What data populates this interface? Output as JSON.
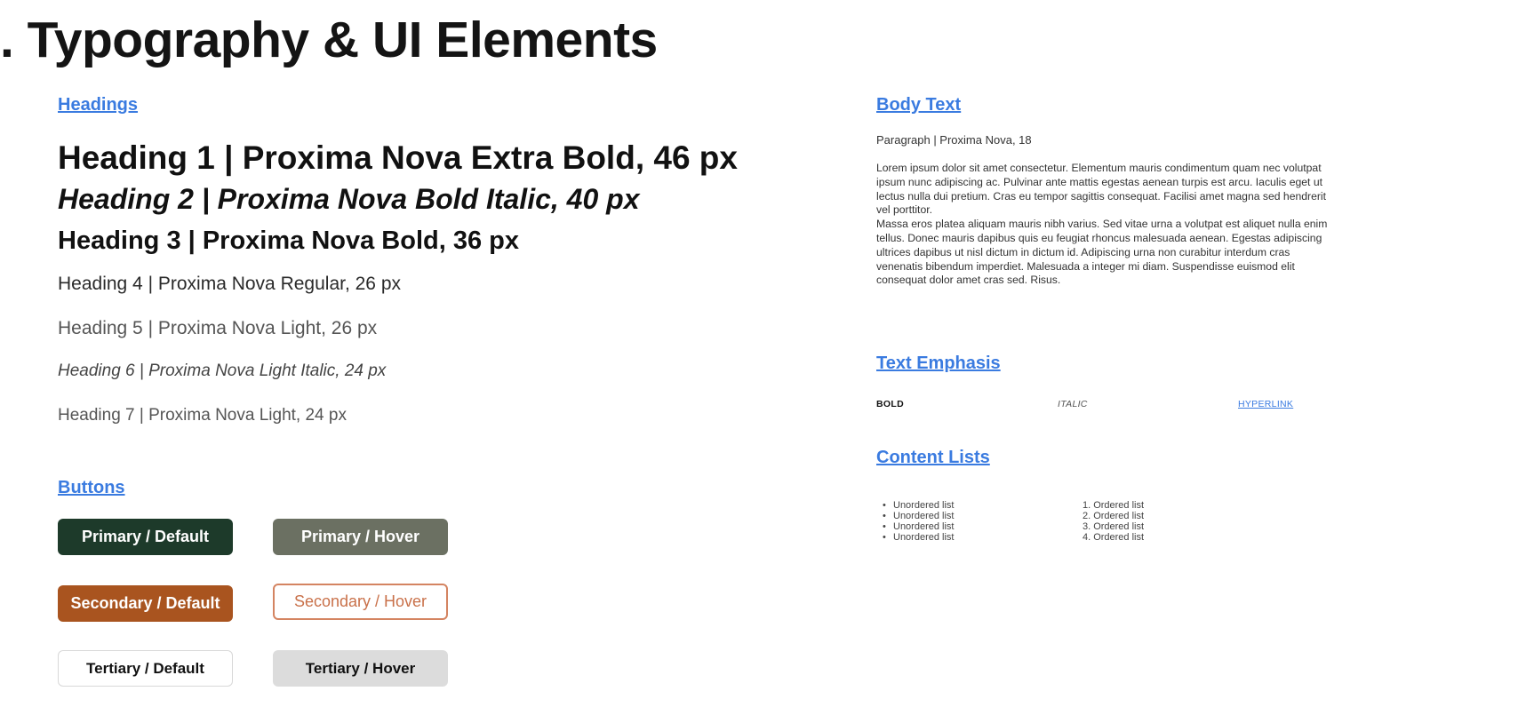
{
  "page": {
    "title": ". Typography & UI Elements"
  },
  "headings": {
    "section_label": "Headings",
    "items": [
      "Heading 1 | Proxima Nova Extra Bold, 46 px",
      "Heading 2 | Proxima Nova Bold Italic, 40 px",
      "Heading 3 | Proxima Nova Bold, 36 px",
      "Heading 4 | Proxima Nova Regular, 26 px",
      "Heading 5 | Proxima Nova Light, 26 px",
      "Heading 6 | Proxima Nova Light Italic, 24 px",
      "Heading 7 | Proxima Nova Light, 24 px"
    ]
  },
  "buttons": {
    "section_label": "Buttons",
    "primary_default": "Primary / Default",
    "primary_hover": "Primary / Hover",
    "secondary_default": "Secondary / Default",
    "secondary_hover": "Secondary / Hover",
    "tertiary_default": "Tertiary / Default",
    "tertiary_hover": "Tertiary / Hover"
  },
  "body_text": {
    "section_label": "Body Text",
    "paragraph_label": "Paragraph | Proxima Nova, 18",
    "paragraph": "Lorem ipsum dolor sit amet consectetur. Elementum mauris condimentum quam nec volutpat ipsum nunc adipiscing ac. Pulvinar ante mattis egestas aenean turpis est arcu. Iaculis eget ut lectus nulla dui pretium. Cras eu tempor sagittis consequat. Facilisi amet magna sed hendrerit vel porttitor.\nMassa eros platea aliquam mauris nibh varius. Sed vitae urna a volutpat est aliquet nulla enim tellus. Donec mauris dapibus quis eu feugiat rhoncus malesuada aenean. Egestas adipiscing ultrices dapibus ut nisl dictum in dictum id. Adipiscing urna non curabitur interdum cras venenatis bibendum imperdiet. Malesuada a integer mi diam. Suspendisse euismod elit consequat dolor amet cras sed. Risus."
  },
  "text_emphasis": {
    "section_label": "Text Emphasis",
    "bold": "BOLD",
    "italic": "ITALIC",
    "hyperlink": "HYPERLINK"
  },
  "content_lists": {
    "section_label": "Content Lists",
    "unordered": [
      "Unordered list",
      "Unordered list",
      "Unordered list",
      "Unordered list"
    ],
    "ordered": [
      "Ordered list",
      "Ordered list",
      "Ordered list",
      "Ordered list"
    ],
    "bullet": "•",
    "ordered_numbers": [
      "1.",
      "2.",
      "3.",
      "4."
    ]
  },
  "colors": {
    "link": "#3a7be0",
    "primary_default": "#1d3a2a",
    "primary_hover": "#6b7062",
    "secondary_default": "#a9541f",
    "secondary_hover_border": "#d48461",
    "tertiary_hover": "#dcdcdc"
  }
}
